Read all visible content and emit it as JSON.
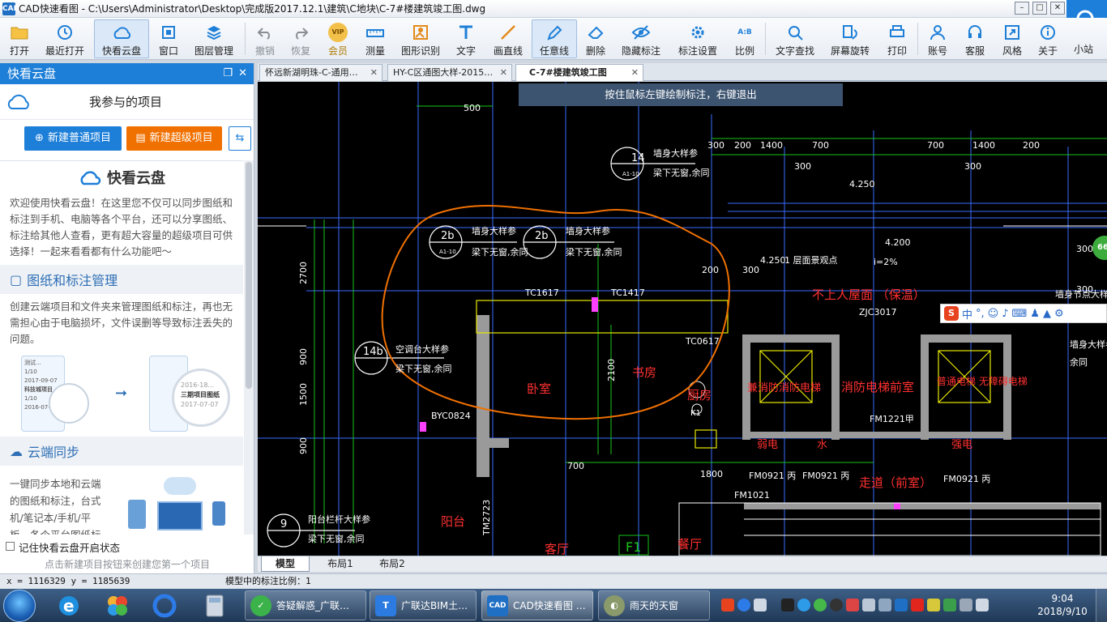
{
  "window": {
    "title": "CAD快速看图 - C:\\Users\\Administrator\\Desktop\\完成版2017.12.1\\建筑\\C地块\\C-7#楼建筑竣工图.dwg",
    "app_icon_text": "CAD"
  },
  "toolbar": {
    "open": "打开",
    "recent": "最近打开",
    "cloud": "快看云盘",
    "window": "窗口",
    "layers": "图层管理",
    "undo": "撤销",
    "redo": "恢复",
    "vip": "会员",
    "vip_badge": "VIP",
    "measure": "测量",
    "shape_recog": "图形识别",
    "text": "文字",
    "draw_line": "画直线",
    "freeform": "任意线",
    "delete": "删除",
    "hide_marks": "隐藏标注",
    "mark_settings": "标注设置",
    "scale": "比例",
    "scale_badge": "A:B",
    "text_search": "文字查找",
    "rotate": "屏幕旋转",
    "print": "打印",
    "account": "账号",
    "service": "客服",
    "style": "风格",
    "about": "关于",
    "station": "小站"
  },
  "left_panel": {
    "header": "快看云盘",
    "project_title": "我参与的项目",
    "new_normal": "新建普通项目",
    "new_super": "新建超级项目",
    "brand_title": "快看云盘",
    "intro": "欢迎使用快看云盘！在这里您不仅可以同步图纸和标注到手机、电脑等各个平台，还可以分享图纸、标注给其他人查看，更有超大容量的超级项目可供选择！一起来看看都有什么功能吧～",
    "sec1_title": "图纸和标注管理",
    "sec1_text": "创建云端项目和文件夹来管理图纸和标注，再也无需担心由于电脑损坏，文件误删等导致标注丢失的问题。",
    "mock_items": [
      "测试...",
      "1/10",
      "2017-09-07",
      "科技城项目",
      "1/10",
      "2016-07-1..."
    ],
    "mock_zoom": [
      "2016-18...",
      "三期项目图纸",
      "2017-07-07"
    ],
    "sec2_title": "云端同步",
    "sec2_text": "一键同步本地和云端的图纸和标注，台式机/笔记本/手机/平板，各个平台图纸标",
    "remember": "记住快看云盘开启状态",
    "bottom_hint": "点击新建项目按钮来创建您第一个项目"
  },
  "tabs": [
    {
      "label": "怀远新湖明珠-C-通用…"
    },
    {
      "label": "HY-C区通图大样-2015…"
    },
    {
      "label": "C-7#楼建筑竣工图"
    }
  ],
  "canvas": {
    "hint": "按住鼠标左键绘制标注，右键退出",
    "ime_label": "中",
    "badge": "66",
    "texts": {
      "d500": "500",
      "d300a": "300",
      "d200": "200",
      "d1400a": "1400",
      "d700a": "700",
      "d300b": "300",
      "d700b": "700",
      "d1400b": "1400",
      "d200b": "200",
      "d300c": "300",
      "d4250a": "4.250",
      "d4250b": "4.250",
      "d4200": "4.200",
      "d300v": "300",
      "d2700": "2700",
      "d900a": "900",
      "d1500": "1500",
      "d900b": "900",
      "d2100": "2100",
      "d700c": "700",
      "d1800": "1800",
      "d200c": "200",
      "d300d": "300",
      "d300e": "300",
      "det14": "14",
      "det14b": "A1-10",
      "det2b1": "2b",
      "det2b2": "2b",
      "det14b1": "14b",
      "det9": "9",
      "detsub": "A1-10",
      "wall1": "墙身大样参",
      "wall1b": "梁下无窗,余同",
      "wall2": "墙身大样参",
      "wall2b": "梁下无窗,余同",
      "wall3": "墙身大样参",
      "wall3b": "梁下无窗,余同",
      "wall4": "空调台大样参",
      "wall4b": "梁下无窗,余同",
      "wall5": "阳台栏杆大样参",
      "wall5b": "梁下无窗,余同",
      "tc1617": "TC1617",
      "tc1417": "TC1417",
      "tc0617": "TC0617",
      "byc": "BYC0824",
      "bedroom": "卧室",
      "study": "书房",
      "kitchen": "厨房",
      "k1": "K1",
      "balcony": "阳台",
      "living": "客厅",
      "dining": "餐厅",
      "roof": "不上人屋面 （保温）",
      "roof2": "1 层面景观点",
      "zjc": "ZJC3017",
      "lift1": "兼消防消防电梯",
      "lift2": "消防电梯前室",
      "lift3": "普通电梯 无障碍电梯",
      "fm1": "FM1221甲",
      "fm2": "FM0921 丙",
      "fm3": "FM0921 丙",
      "fm4": "FM0921 丙",
      "fm5": "FM1021 丙",
      "fm6": "FM1021",
      "corridor": "走道（前室）",
      "elec": "弱电",
      "water": "水",
      "strong": "强电",
      "f1": "F1",
      "tmr": "TM2723",
      "node1": "墙身节点大样详",
      "node2": "墙身大样参",
      "node2b": "余同",
      "slope": "i=2%"
    }
  },
  "layout_tabs": [
    "模型",
    "布局1",
    "布局2"
  ],
  "status": {
    "coords": "x = 1116329  y = 1185639",
    "scale": "模型中的标注比例：1"
  },
  "taskbar": {
    "tasks": [
      "答疑解惑_广联…",
      "广联达BIM土…",
      "CAD快速看图 …",
      "雨天的天窗"
    ],
    "clock_time": "9:04",
    "clock_date": "2018/9/10"
  },
  "colors": {
    "accent": "#1e7fd8",
    "orange": "#f07000",
    "canvas_bg": "#000000"
  }
}
